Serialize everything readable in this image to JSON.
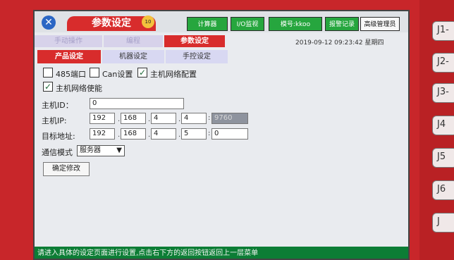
{
  "window": {
    "title": "参数设定",
    "badge": "10",
    "logo_icon": "tools-icon",
    "accent_red": "#d82c2c",
    "accent_green": "#26a63e"
  },
  "toolbar": {
    "buttons": [
      {
        "label": "计算器"
      },
      {
        "label": "I/O监视"
      },
      {
        "label": "模号:kkoo"
      },
      {
        "label": "报警记录"
      },
      {
        "label": "高级管理员"
      }
    ]
  },
  "main_nav": {
    "tabs": [
      {
        "label": "手动操作"
      },
      {
        "label": "编程"
      },
      {
        "label": "参数设定"
      }
    ]
  },
  "datetime": "2019-09-12   09:23:42   星期四",
  "sub_nav": {
    "tabs": [
      {
        "label": "产品设定"
      },
      {
        "label": "机器设定"
      },
      {
        "label": "手控设定"
      }
    ]
  },
  "form": {
    "port_485_label": "485端口",
    "can_label": "Can设置",
    "host_net_config_label": "主机网络配置",
    "host_net_enable_label": "主机网络使能",
    "host_id_label": "主机ID：",
    "host_id_value": "0",
    "host_ip_label": "主机IP:",
    "host_ip": [
      "192",
      "168",
      "4",
      "4"
    ],
    "host_port": "9760",
    "target_label": "目标地址:",
    "target_ip": [
      "192",
      "168",
      "4",
      "5"
    ],
    "target_port": "0",
    "comm_mode_label": "通信模式",
    "comm_mode_value": "服务器",
    "confirm_label": "确定修改"
  },
  "status_bar": "请进入具体的设定页面进行设置,点击右下方的返回按钮返回上一层菜单",
  "side_buttons": [
    "J1-",
    "J2-",
    "J3-",
    "J4",
    "J5",
    "J6",
    "J"
  ]
}
